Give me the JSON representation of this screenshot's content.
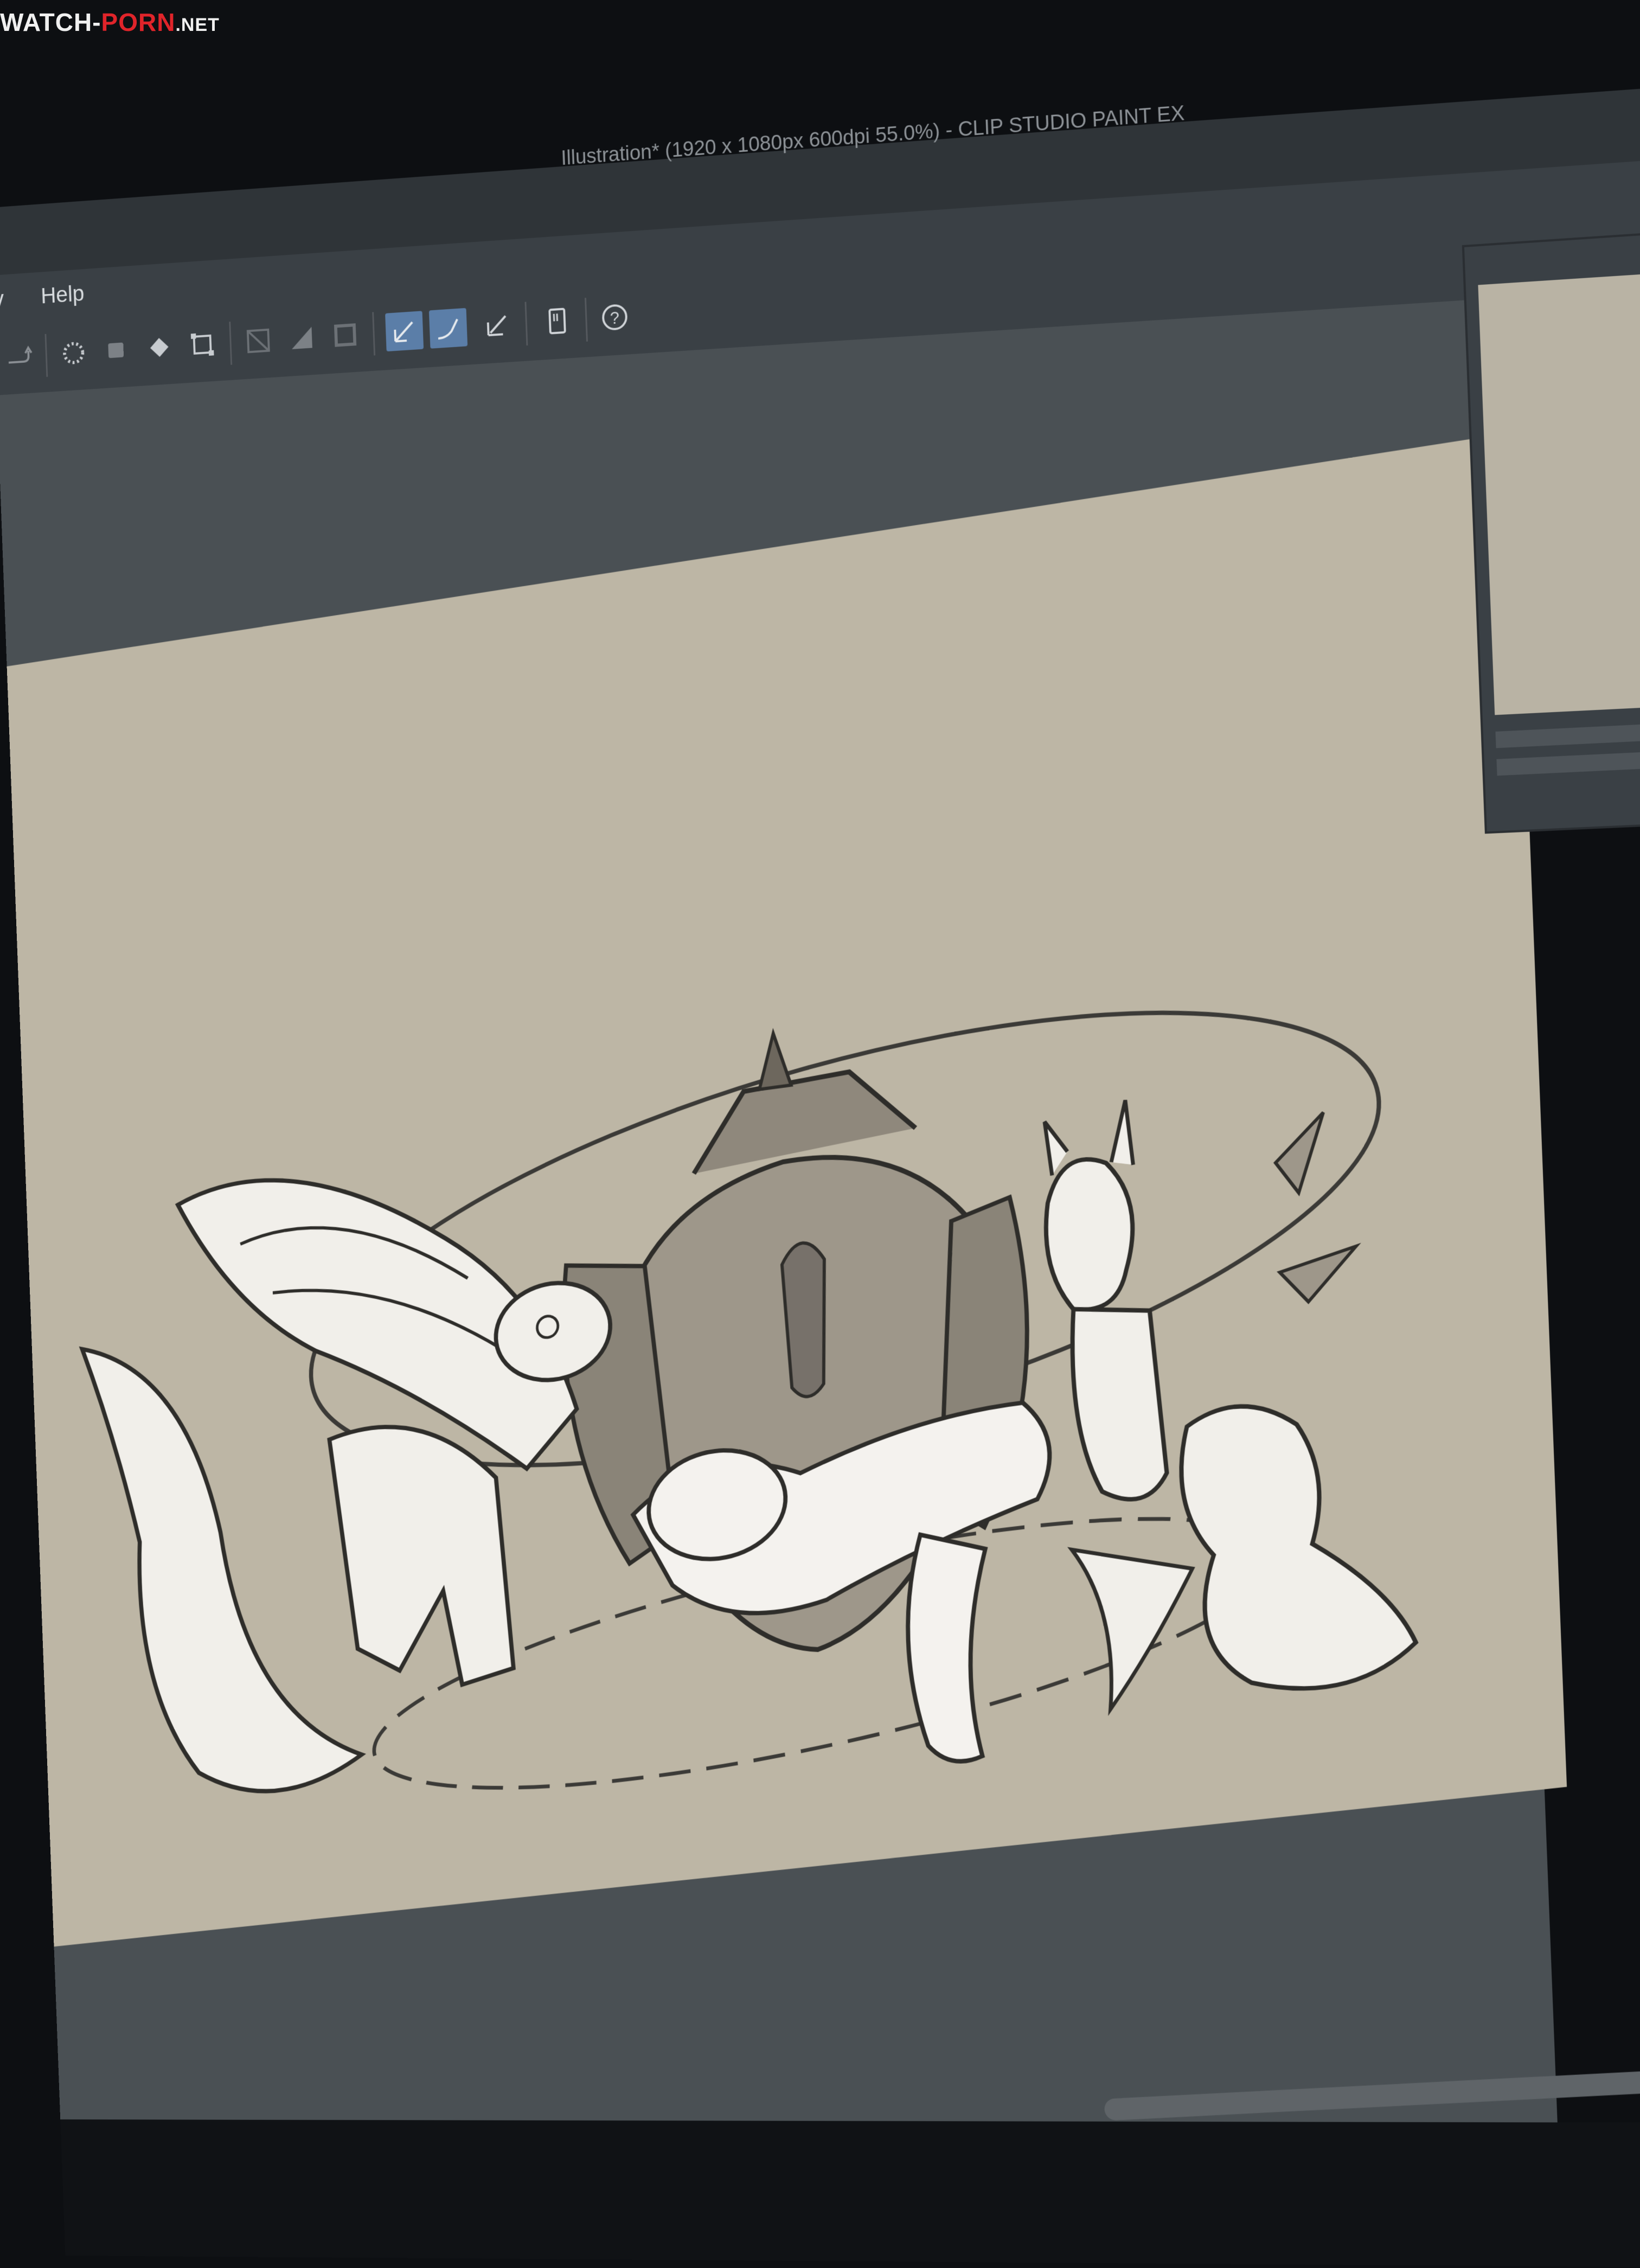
{
  "watermark": {
    "part1": "WATCH-",
    "part2": "PORN",
    "part3": ".NET"
  },
  "window": {
    "title": "Illustration* (1920 x 1080px 600dpi 55.0%)  - CLIP STUDIO PAINT EX"
  },
  "menu": {
    "partial_item": "v",
    "help": "Help"
  },
  "toolbar": {
    "icons": [
      "redo-icon",
      "loading-icon",
      "fill-icon",
      "fill-color-icon",
      "transform-icon",
      "clear-outside-icon",
      "fill-selection-icon",
      "border-icon",
      "pen-icon",
      "brush-icon",
      "ruler-icon",
      "tablet-icon",
      "help-icon"
    ]
  },
  "colors": {
    "canvas": "#bdb6a5",
    "workspace": "#4a5054",
    "ui_dark": "#3a4045",
    "active_tool": "#5b7ea8"
  }
}
